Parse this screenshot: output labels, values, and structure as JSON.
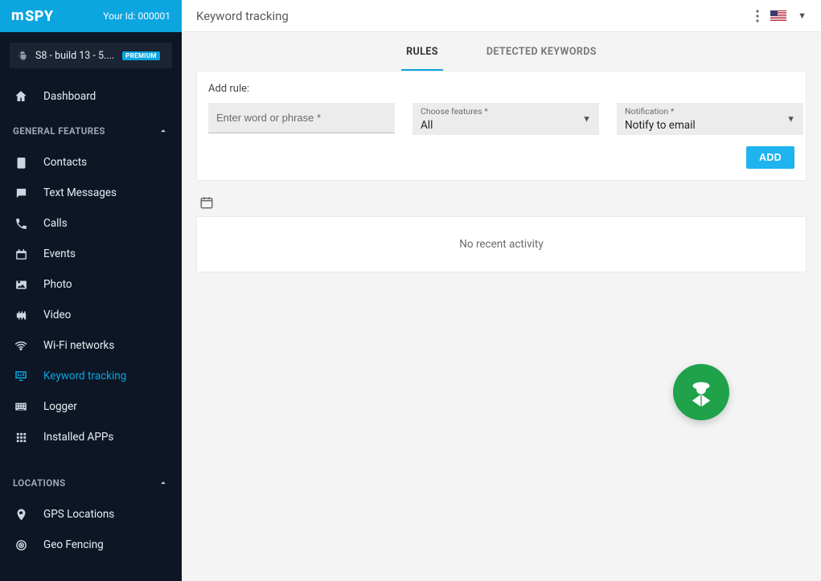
{
  "brand": "mSPY",
  "header": {
    "user_id_label": "Your Id: 000001",
    "page_title": "Keyword tracking"
  },
  "device": {
    "name": "S8 - build 13 - 5....",
    "badge": "PREMIUM"
  },
  "sidebar": {
    "dashboard": "Dashboard",
    "sections": {
      "general": "GENERAL FEATURES",
      "locations": "LOCATIONS"
    },
    "general_items": [
      {
        "label": "Contacts",
        "icon": "clipboard-icon"
      },
      {
        "label": "Text Messages",
        "icon": "message-icon"
      },
      {
        "label": "Calls",
        "icon": "phone-icon"
      },
      {
        "label": "Events",
        "icon": "calendar-icon"
      },
      {
        "label": "Photo",
        "icon": "image-icon"
      },
      {
        "label": "Video",
        "icon": "film-icon"
      },
      {
        "label": "Wi-Fi networks",
        "icon": "wifi-icon"
      },
      {
        "label": "Keyword tracking",
        "icon": "monitor-icon",
        "active": true
      },
      {
        "label": "Logger",
        "icon": "keyboard-icon"
      },
      {
        "label": "Installed APPs",
        "icon": "grid-icon"
      }
    ],
    "location_items": [
      {
        "label": "GPS Locations",
        "icon": "pin-icon"
      },
      {
        "label": "Geo Fencing",
        "icon": "target-icon"
      }
    ]
  },
  "tabs": {
    "rules": "RULES",
    "detected": "DETECTED KEYWORDS"
  },
  "rule_form": {
    "title": "Add rule:",
    "word_placeholder": "Enter word or phrase *",
    "features_label": "Choose features *",
    "features_value": "All",
    "notification_label": "Notification *",
    "notification_value": "Notify to email",
    "add_button": "ADD"
  },
  "activity": {
    "empty": "No recent activity"
  },
  "locale": {
    "flag": "us"
  }
}
